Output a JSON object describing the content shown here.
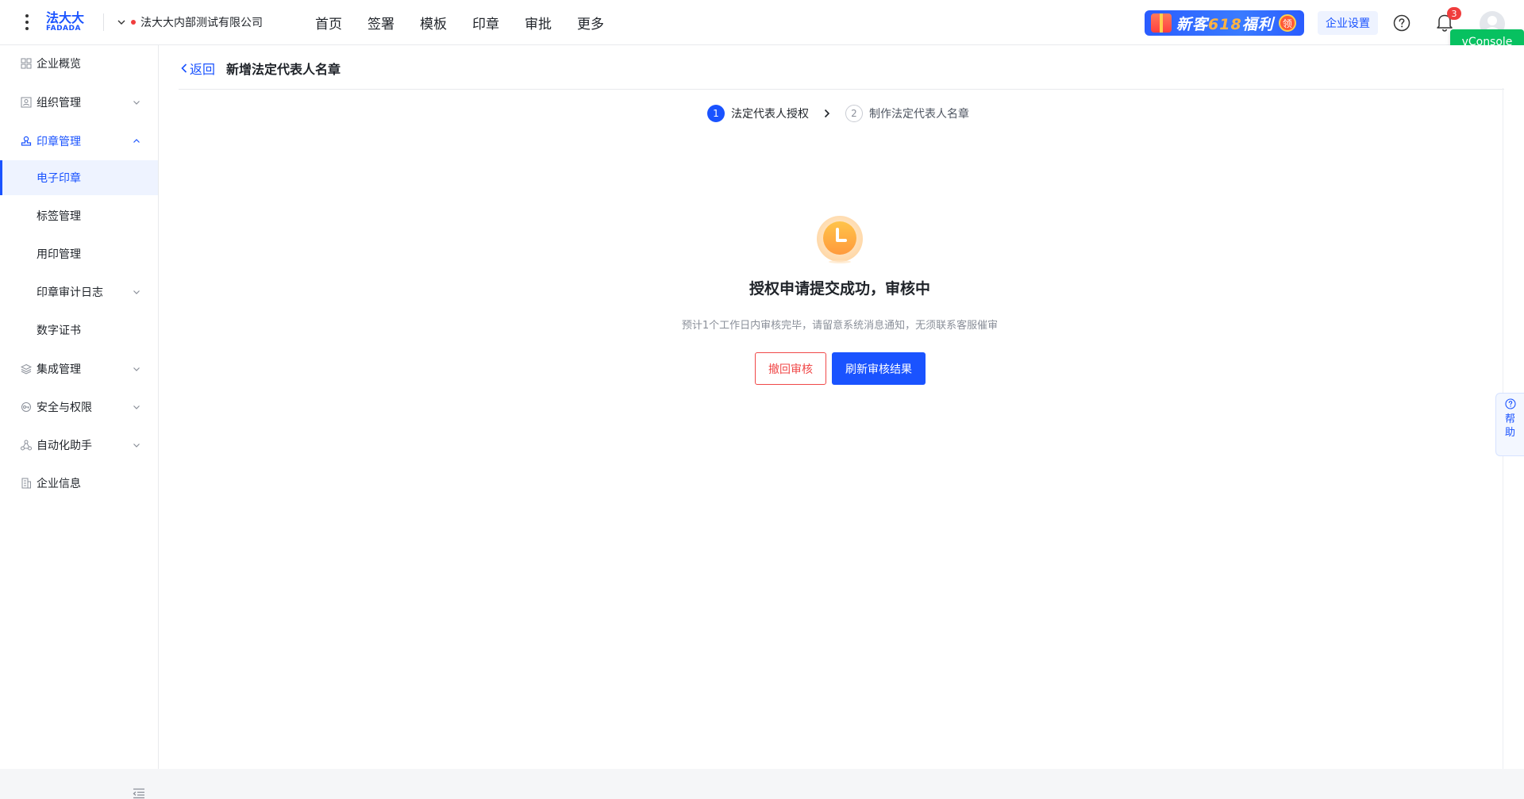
{
  "header": {
    "logo_cn": "法大大",
    "logo_en": "FADADA",
    "company_name": "法大大内部测试有限公司",
    "nav": [
      "首页",
      "签署",
      "模板",
      "印章",
      "审批",
      "更多"
    ],
    "promo": {
      "prefix": "新客",
      "number": "618",
      "suffix": "福利",
      "badge": "领"
    },
    "settings_label": "企业设置",
    "notification_count": "3",
    "vconsole_label": "vConsole"
  },
  "sidebar": {
    "items": [
      {
        "label": "企业概览"
      },
      {
        "label": "组织管理"
      },
      {
        "label": "印章管理"
      },
      {
        "label": "电子印章"
      },
      {
        "label": "标签管理"
      },
      {
        "label": "用印管理"
      },
      {
        "label": "印章审计日志"
      },
      {
        "label": "数字证书"
      },
      {
        "label": "集成管理"
      },
      {
        "label": "安全与权限"
      },
      {
        "label": "自动化助手"
      },
      {
        "label": "企业信息"
      }
    ]
  },
  "page": {
    "back_label": "返回",
    "title": "新增法定代表人名章",
    "steps": [
      {
        "num": "1",
        "label": "法定代表人授权"
      },
      {
        "num": "2",
        "label": "制作法定代表人名章"
      }
    ],
    "status_title": "授权申请提交成功，审核中",
    "status_desc": "预计1个工作日内审核完毕，请留意系统消息通知，无须联系客服催审",
    "withdraw_label": "撤回审核",
    "refresh_label": "刷新审核结果"
  },
  "help_tab": {
    "line1": "帮",
    "line2": "助"
  },
  "colors": {
    "primary": "#1a53ff",
    "danger": "#f04848",
    "success": "#07c160"
  }
}
